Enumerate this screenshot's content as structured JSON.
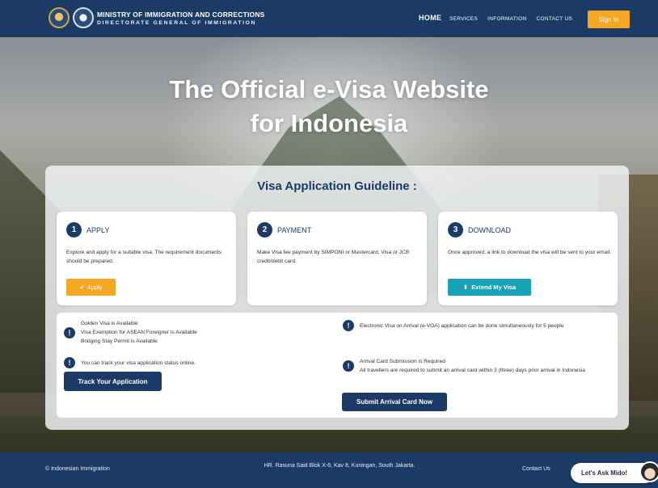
{
  "nav": {
    "brand_line1": "MINISTRY OF IMMIGRATION AND CORRECTIONS",
    "brand_line2": "DIRECTORATE GENERAL OF IMMIGRATION",
    "home": "HOME",
    "services": "SERVICES",
    "information": "INFORMATION",
    "contact": "CONTACT US",
    "signin": "Sign In"
  },
  "hero": {
    "title_line1": "The Official e-Visa Website",
    "title_line2": "for Indonesia"
  },
  "guideline": {
    "title": "Visa Application Guideline :",
    "steps": [
      {
        "number": "1",
        "title": "APPLY",
        "description": "Explore and apply for a suitable visa. The requirement documents should be prepared.",
        "button": "Apply"
      },
      {
        "number": "2",
        "title": "PAYMENT",
        "description": "Make Visa fee payment by SIMPONI or Mastercard, Visa or JCB credit/debit card."
      },
      {
        "number": "3",
        "title": "DOWNLOAD",
        "description": "Once approved, a link to download the visa will be sent to your email.",
        "button": "Extend My Visa"
      }
    ]
  },
  "info": {
    "left_group1": [
      "Golden Visa is Available",
      "Visa Exemption for ASEAN Foreigner is Available",
      "Bridging Stay Permit is Available"
    ],
    "left_track_text": "You can track your visa application status online.",
    "track_button": "Track Your Application",
    "right_evoa": "Electronic Visa on Arrival (e-VOA) application can be done simultaneously for 5 people",
    "right_arrival_title": "Arrival Card Submission is Required",
    "right_arrival_text": "All travellers are required to submit an arrival card within 3 (three) days prior arrival in Indonesia",
    "arrival_button": "Submit Arrival Card Now"
  },
  "footer": {
    "copyright": "© Indonesian Immigration",
    "address": "HR. Rasuna Said Blok X-6, Kav 8, Kuningan, South Jakarta.",
    "contact": "Contact Us"
  },
  "chat": {
    "label": "Let's Ask Mido!"
  },
  "colors": {
    "navy": "#1c3a66",
    "orange": "#f5a623",
    "teal": "#17a2b8"
  }
}
